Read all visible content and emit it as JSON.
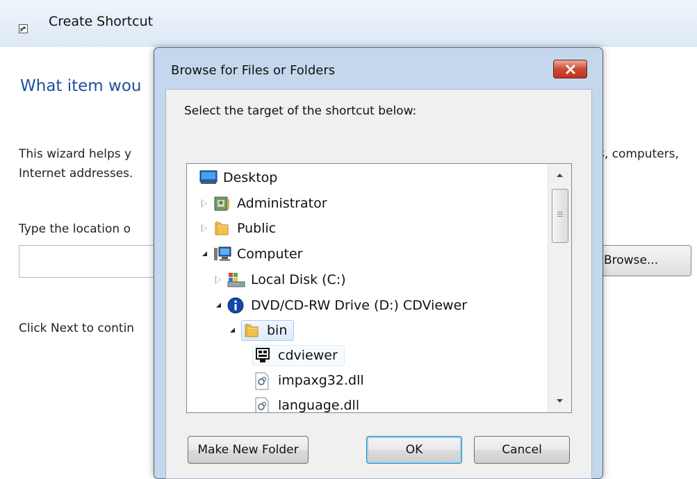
{
  "wizard": {
    "title": "Create Shortcut",
    "heading_visible": "What item wou",
    "description_line1_left": "This wizard helps y",
    "description_line1_right": "s, computers,",
    "description_line2": "Internet addresses.",
    "location_label_visible": "Type the location o",
    "location_value": "",
    "browse_label": "Browse...",
    "next_hint_visible": "Click Next to contin"
  },
  "dialog": {
    "title": "Browse for Files or Folders",
    "instruction": "Select the target of the shortcut below:",
    "tree": [
      {
        "label": "Desktop",
        "icon": "desktop-icon",
        "expander": "none",
        "level": 0
      },
      {
        "label": "Administrator",
        "icon": "user-folder-icon",
        "expander": "collapsed",
        "level": 1
      },
      {
        "label": "Public",
        "icon": "folder-icon",
        "expander": "collapsed",
        "level": 1
      },
      {
        "label": "Computer",
        "icon": "computer-icon",
        "expander": "expanded",
        "level": 1
      },
      {
        "label": "Local Disk (C:)",
        "icon": "local-disk-icon",
        "expander": "collapsed",
        "level": 2
      },
      {
        "label": "DVD/CD-RW Drive (D:) CDViewer",
        "icon": "dvd-drive-icon",
        "expander": "expanded",
        "level": 2
      },
      {
        "label": "bin",
        "icon": "folder-icon",
        "expander": "expanded",
        "level": 3,
        "selected": true
      },
      {
        "label": "cdviewer",
        "icon": "application-icon",
        "expander": "none",
        "level": 4
      },
      {
        "label": "impaxg32.dll",
        "icon": "dll-file-icon",
        "expander": "none",
        "level": 4
      },
      {
        "label": "language.dll",
        "icon": "dll-file-icon",
        "expander": "none",
        "level": 4
      }
    ],
    "buttons": {
      "make_new_folder": "Make New Folder",
      "ok": "OK",
      "cancel": "Cancel"
    }
  },
  "colors": {
    "wizard_heading": "#1e4f9c",
    "dialog_frame": "#c4d7ed",
    "close_button": "#c3321d",
    "selection": "#dcebfb"
  }
}
